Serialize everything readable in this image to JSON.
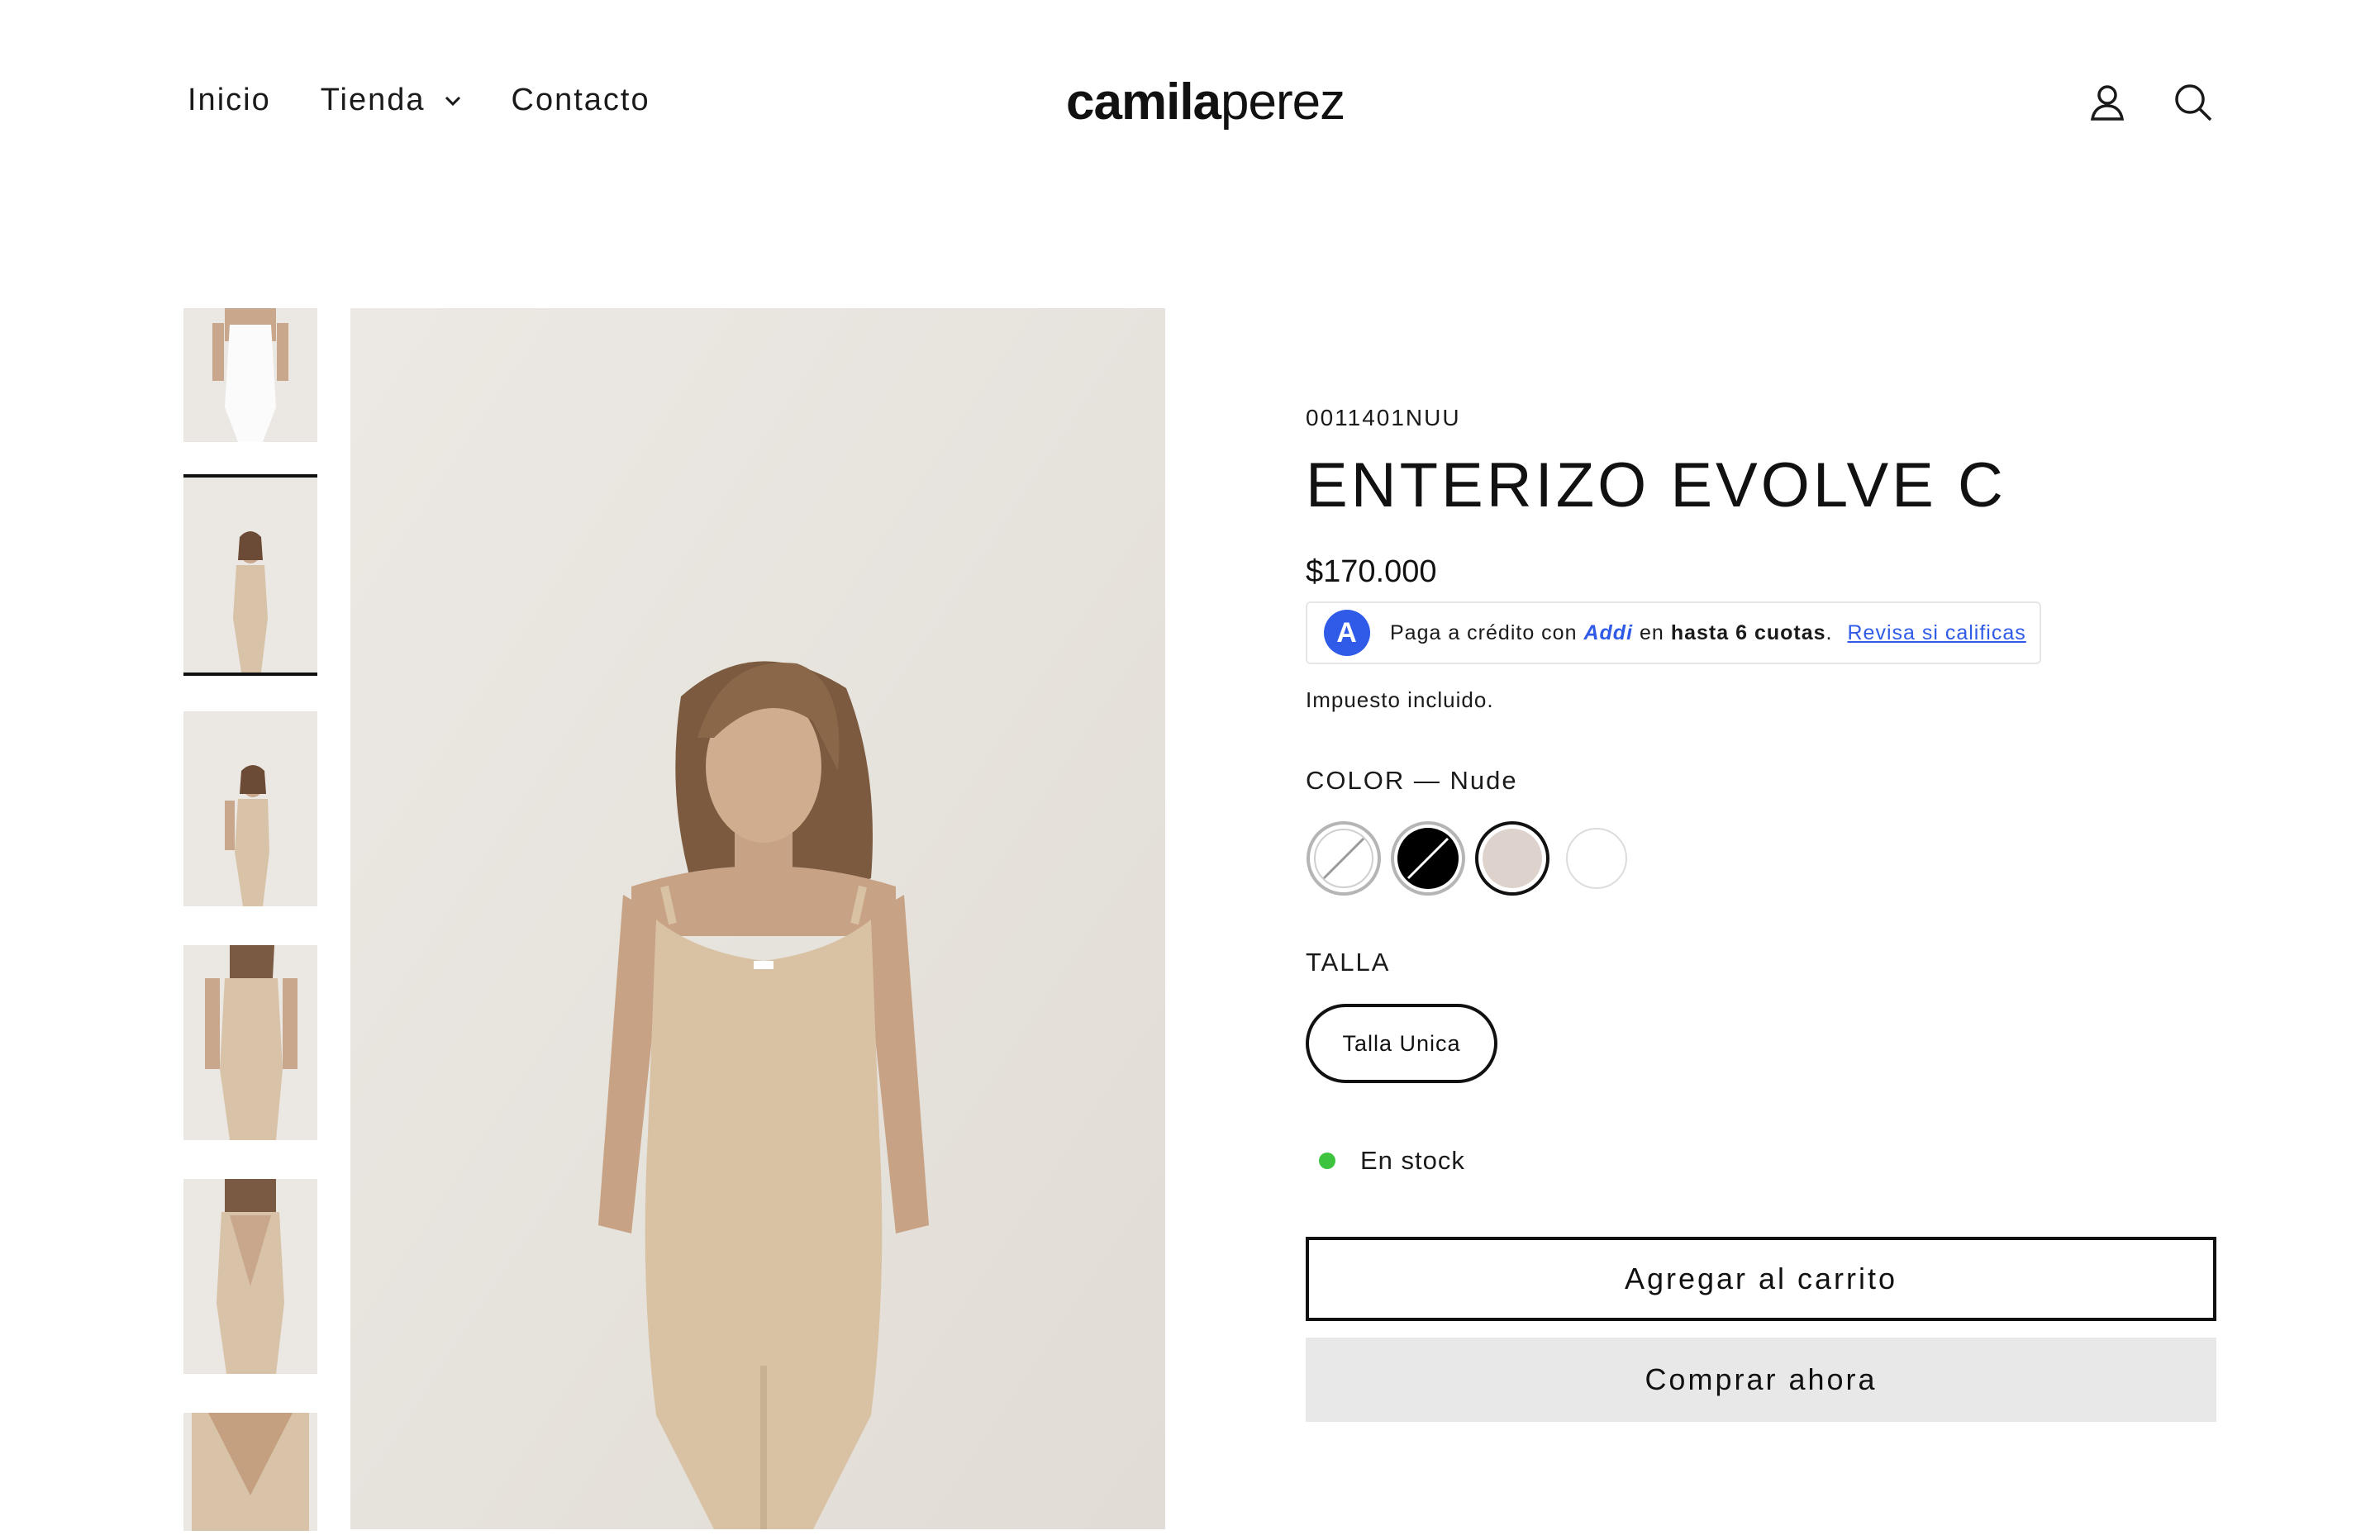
{
  "header": {
    "nav": [
      {
        "label": "Inicio"
      },
      {
        "label": "Tienda"
      },
      {
        "label": "Contacto"
      }
    ],
    "logo": {
      "part1": "camila",
      "part2": "perez"
    },
    "icons": [
      "account-icon",
      "search-icon"
    ]
  },
  "product": {
    "sku": "0011401NUU",
    "title": "ENTERIZO EVOLVE C",
    "price": "$170.000",
    "addi": {
      "logo_letter": "A",
      "text_before": "Paga a crédito con",
      "brand": "Addi",
      "text_mid": "en",
      "strong": "hasta 6 cuotas",
      "period": ".",
      "link": "Revisa si calificas"
    },
    "tax_note": "Impuesto incluido.",
    "color_label": "COLOR — Nude",
    "colors": [
      {
        "name": "Blanco",
        "hex": "#ffffff",
        "state": "unavailable"
      },
      {
        "name": "Negro",
        "hex": "#000000",
        "state": "unavailable"
      },
      {
        "name": "Nude",
        "hex": "#ded3cc",
        "state": "selected"
      },
      {
        "name": "Blanco 2",
        "hex": "#ffffff",
        "state": "available"
      }
    ],
    "size_label": "TALLA",
    "size_option": "Talla Unica",
    "stock": "En stock",
    "add_to_cart": "Agregar al carrito",
    "buy_now": "Comprar ahora"
  },
  "gallery": {
    "active_thumb": 2,
    "thumb_count": 6
  },
  "colors": {
    "accent_blue": "#2f5be8",
    "stock_green": "#3ec33e",
    "buy_bg": "#e8e8e8",
    "nude": "#d8c3a8"
  }
}
